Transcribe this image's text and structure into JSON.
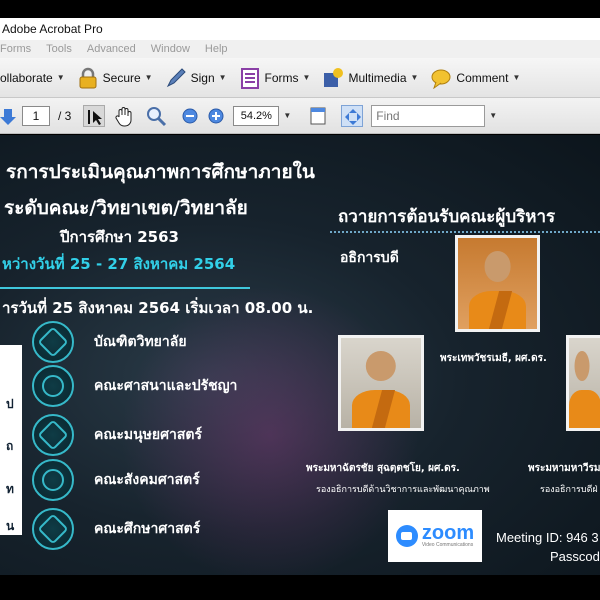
{
  "window": {
    "title": "Adobe Acrobat Pro"
  },
  "menu": [
    "Forms",
    "Tools",
    "Advanced",
    "Window",
    "Help"
  ],
  "toolbar1": {
    "collaborate": "ollaborate",
    "secure": "Secure",
    "sign": "Sign",
    "forms": "Forms",
    "multimedia": "Multimedia",
    "comment": "Comment"
  },
  "toolbar2": {
    "page_current": "1",
    "page_total": "/ 3",
    "zoom": "54.2%",
    "find_placeholder": "Find"
  },
  "slide": {
    "line1": "รการประเมินคุณภาพการศึกษาภายใน",
    "line2": "ระดับคณะ/วิทยาเขต/วิทยาลัย",
    "line3": "ปีการศึกษา 2563",
    "line4": "หว่างวันที่ 25 - 27 สิงหาคม  2564",
    "line5": "ารวันที่ 25 สิงหาคม 2564 เริ่มเวลา 08.00 น.",
    "faculties": [
      "บัณฑิตวิทยาลัย",
      "คณะศาสนาและปรัชญา",
      "คณะมนุษยศาสตร์",
      "คณะสังคมศาสตร์",
      "คณะศึกษาศาสตร์"
    ],
    "panel_chars": [
      "ป",
      "ถ",
      "ท",
      "น"
    ],
    "right_title": "ถวายการต้อนรับคณะผู้บริหาร",
    "role": "อธิการบดี",
    "monk1_name": "พระเทพวัชรเมธี, ผศ.ดร.",
    "monk2_name": "พระมหาฉัตรชัย สุฉตฺตชโย, ผศ.ดร.",
    "monk2_sub": "รองอธิการบดีด้านวิชาการและพัฒนาคุณภาพ",
    "monk3_name": "พระมหามหาวีรม",
    "monk3_sub": "รองอธิการบดีฝ่",
    "zoom_word": "zoom",
    "zoom_tag": "Video Communications",
    "meeting": "Meeting ID: 946 3",
    "passcode": "Passcod"
  }
}
